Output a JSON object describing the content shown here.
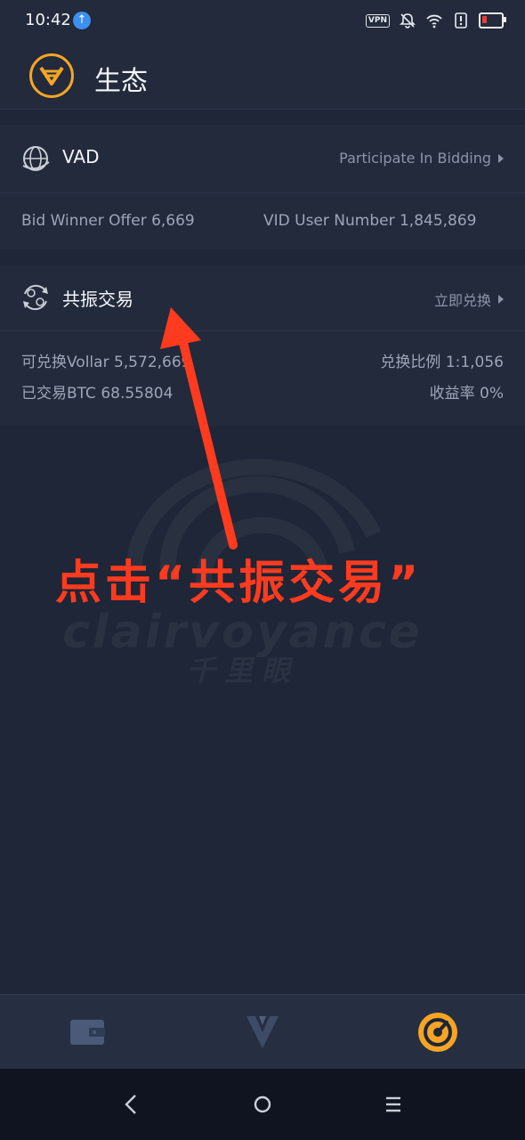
{
  "status_bar": {
    "time": "10:42",
    "vpn_label": "VPN",
    "icons": [
      "upload-icon",
      "vpn-icon",
      "mute-icon",
      "wifi-icon",
      "alert-icon",
      "battery-icon"
    ],
    "battery_color": "#e0413a"
  },
  "header": {
    "title": "生态",
    "logo_icon": "vollar-logo-icon",
    "accent": "#f5a524"
  },
  "vad_card": {
    "icon": "globe-icon",
    "title": "VAD",
    "action": "Participate In Bidding",
    "bid_winner": "Bid Winner Offer 6,669",
    "vid_users": "VID User Number 1,845,869"
  },
  "resonance_card": {
    "icon": "exchange-icon",
    "title": "共振交易",
    "action": "立即兑换",
    "exchangeable": "可兑换Vollar 5,572,669",
    "ratio": "兑换比例 1:1,056",
    "traded": "已交易BTC 68.55804",
    "yield": "收益率 0%"
  },
  "annotation": {
    "text": "点击“共振交易”",
    "color": "#ff3b1f"
  },
  "watermark": {
    "text": "clairvoyance",
    "subtext": "千里眼"
  },
  "tab_bar": {
    "tabs": [
      "wallet-icon",
      "vollar-v-icon",
      "ecosystem-icon"
    ],
    "active_color": "#f5a524"
  },
  "nav_bar": {
    "buttons": [
      "back-icon",
      "home-icon",
      "menu-icon"
    ]
  }
}
